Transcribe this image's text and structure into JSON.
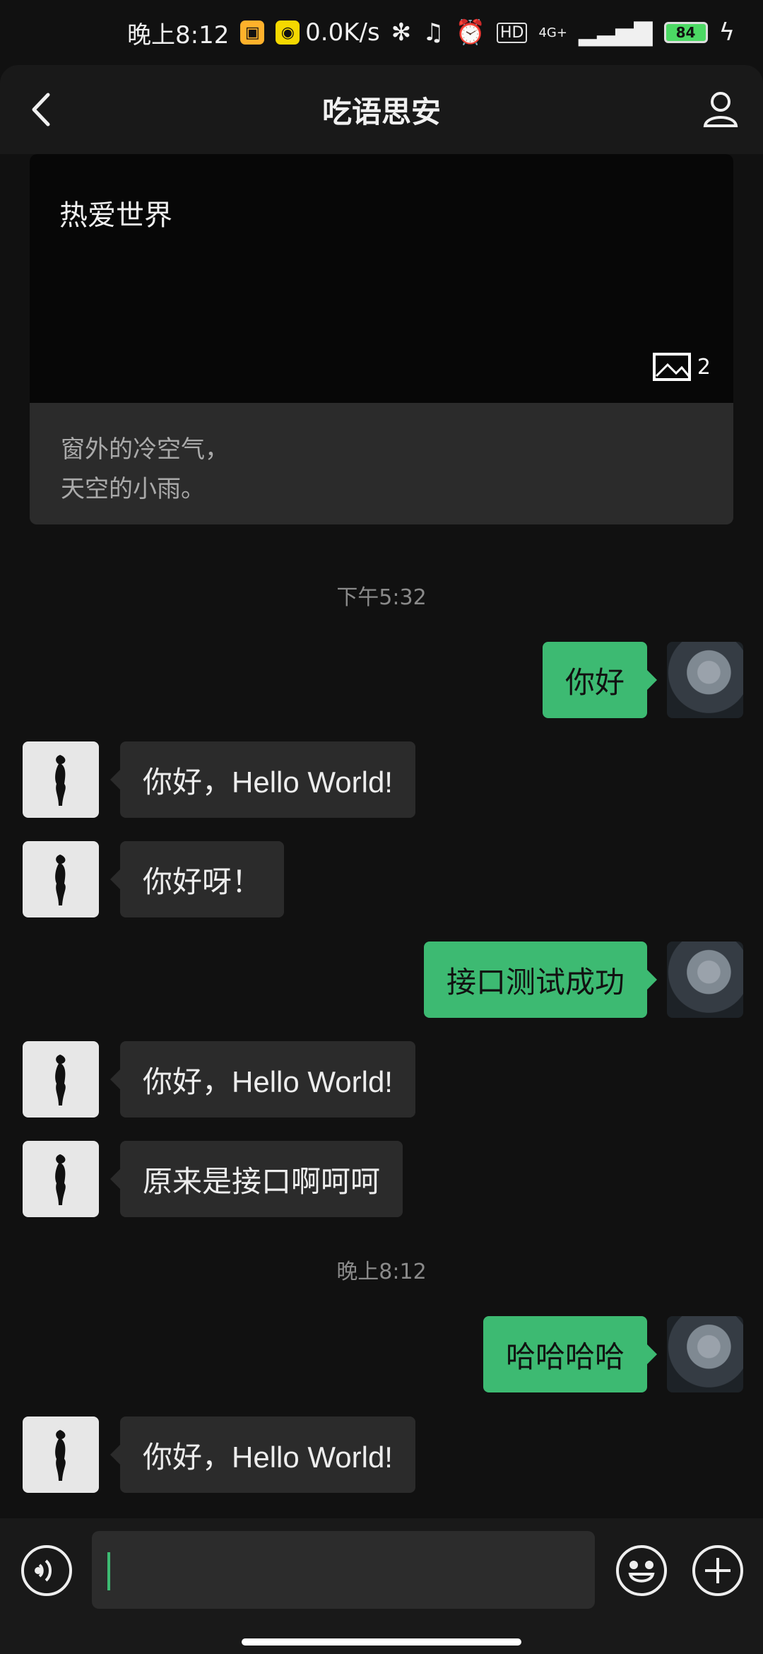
{
  "status_bar": {
    "time": "晚上8:12",
    "network_speed": "0.0K/s",
    "hd": "HD",
    "network": "4G+",
    "battery": "84"
  },
  "header": {
    "title": "吃语思安"
  },
  "article": {
    "heading": "热爱世界",
    "image_count": "2",
    "source": "吃语思安",
    "caption_line1": "窗外的冷空气，",
    "caption_line2": "天空的小雨。"
  },
  "times": {
    "afternoon": "下午5:32",
    "evening": "晚上8:12"
  },
  "messages": [
    {
      "from": "self",
      "text": "你好"
    },
    {
      "from": "contact",
      "text": "你好，Hello World!"
    },
    {
      "from": "contact",
      "text": "你好呀！"
    },
    {
      "from": "self",
      "text": "接口测试成功"
    },
    {
      "from": "contact",
      "text": "你好，Hello World!"
    },
    {
      "from": "contact",
      "text": "原来是接口啊呵呵"
    },
    {
      "from": "self",
      "text": "哈哈哈哈"
    },
    {
      "from": "contact",
      "text": "你好，Hello World!"
    }
  ],
  "input": {
    "value": "",
    "placeholder": ""
  },
  "icons": {
    "back": "chevron-left-icon",
    "profile": "person-icon",
    "voice": "voice-icon",
    "emoji": "emoji-icon",
    "add": "plus-icon"
  },
  "colors": {
    "accent": "#3dba72",
    "background": "#111111",
    "bubble_dark": "#2b2b2b"
  }
}
